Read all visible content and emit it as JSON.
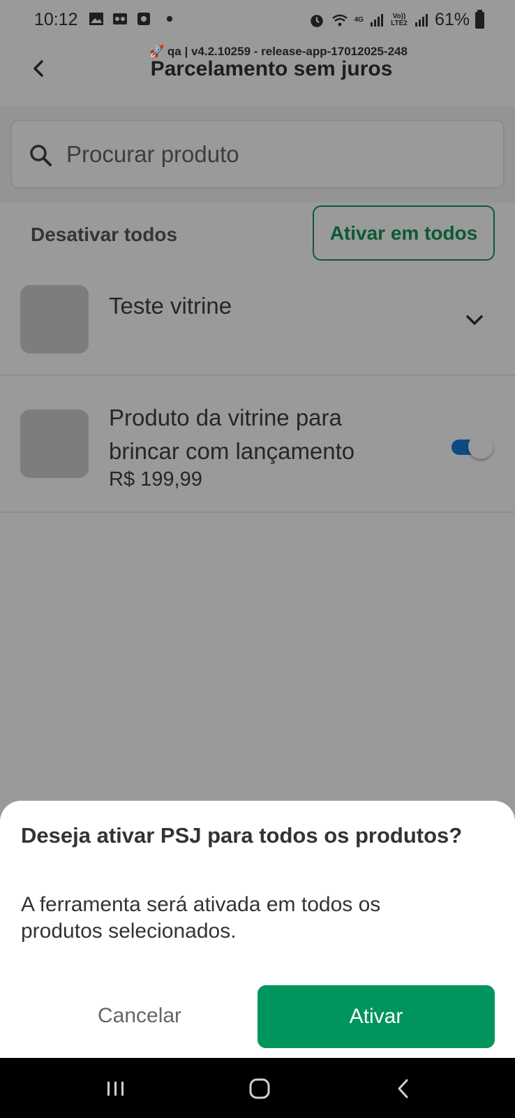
{
  "status_bar": {
    "time": "10:12",
    "battery": "61%",
    "network_label": "4G",
    "volte_label": "Vo)) LTE2"
  },
  "header": {
    "build_label": "🚀 qa | v4.2.10259 - release-app-17012025-248",
    "title": "Parcelamento sem juros"
  },
  "search": {
    "placeholder": "Procurar produto",
    "value": ""
  },
  "actions": {
    "disable_all": "Desativar todos",
    "enable_all": "Ativar em todos"
  },
  "products": [
    {
      "name": "Teste vitrine",
      "price": "",
      "control": "expand"
    },
    {
      "name": "Produto da vitrine para brincar com lançamento",
      "price": "R$ 199,99",
      "control": "toggle",
      "enabled": true
    }
  ],
  "dialog": {
    "title": "Deseja ativar PSJ para todos os produtos?",
    "body": "A ferramenta será ativada em todos os produtos selecionados.",
    "cancel_label": "Cancelar",
    "confirm_label": "Ativar"
  },
  "colors": {
    "accent_green": "#00955d",
    "dark_green": "#0b5a33",
    "toggle_blue": "#0d4a86"
  },
  "icons": [
    "back-icon",
    "search-icon",
    "chevron-down-icon",
    "recents-icon",
    "home-icon",
    "nav-back-icon"
  ]
}
